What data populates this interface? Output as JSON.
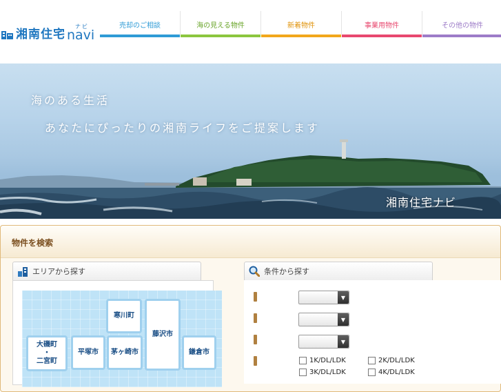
{
  "header": {
    "logo_text": "湘南住宅",
    "logo_navi": "navi",
    "logo_ruby": "ナビ",
    "nav": [
      {
        "label": "売却のご相談",
        "color": "#2f9bd6"
      },
      {
        "label": "海の見える物件",
        "color": "#8cc63f"
      },
      {
        "label": "新着物件",
        "color": "#f2a71b"
      },
      {
        "label": "事業用物件",
        "color": "#e8486f"
      },
      {
        "label": "その他の物件",
        "color": "#9d7cc8"
      }
    ]
  },
  "hero": {
    "line1": "海のある生活",
    "line2": "あなたにぴったりの湘南ライフをご提案します",
    "brand": "湘南住宅ナビ"
  },
  "search": {
    "title": "物件を検索",
    "area_title": "エリアから探す",
    "cond_title": "条件から探す",
    "cities": [
      "寒川町",
      "藤沢市",
      "大磯町\n・\n二宮町",
      "平塚市",
      "茅ヶ崎市",
      "鎌倉市"
    ],
    "checkboxes": [
      "1K/DL/LDK",
      "2K/DL/LDK",
      "3K/DL/LDK",
      "4K/DL/LDK"
    ]
  }
}
